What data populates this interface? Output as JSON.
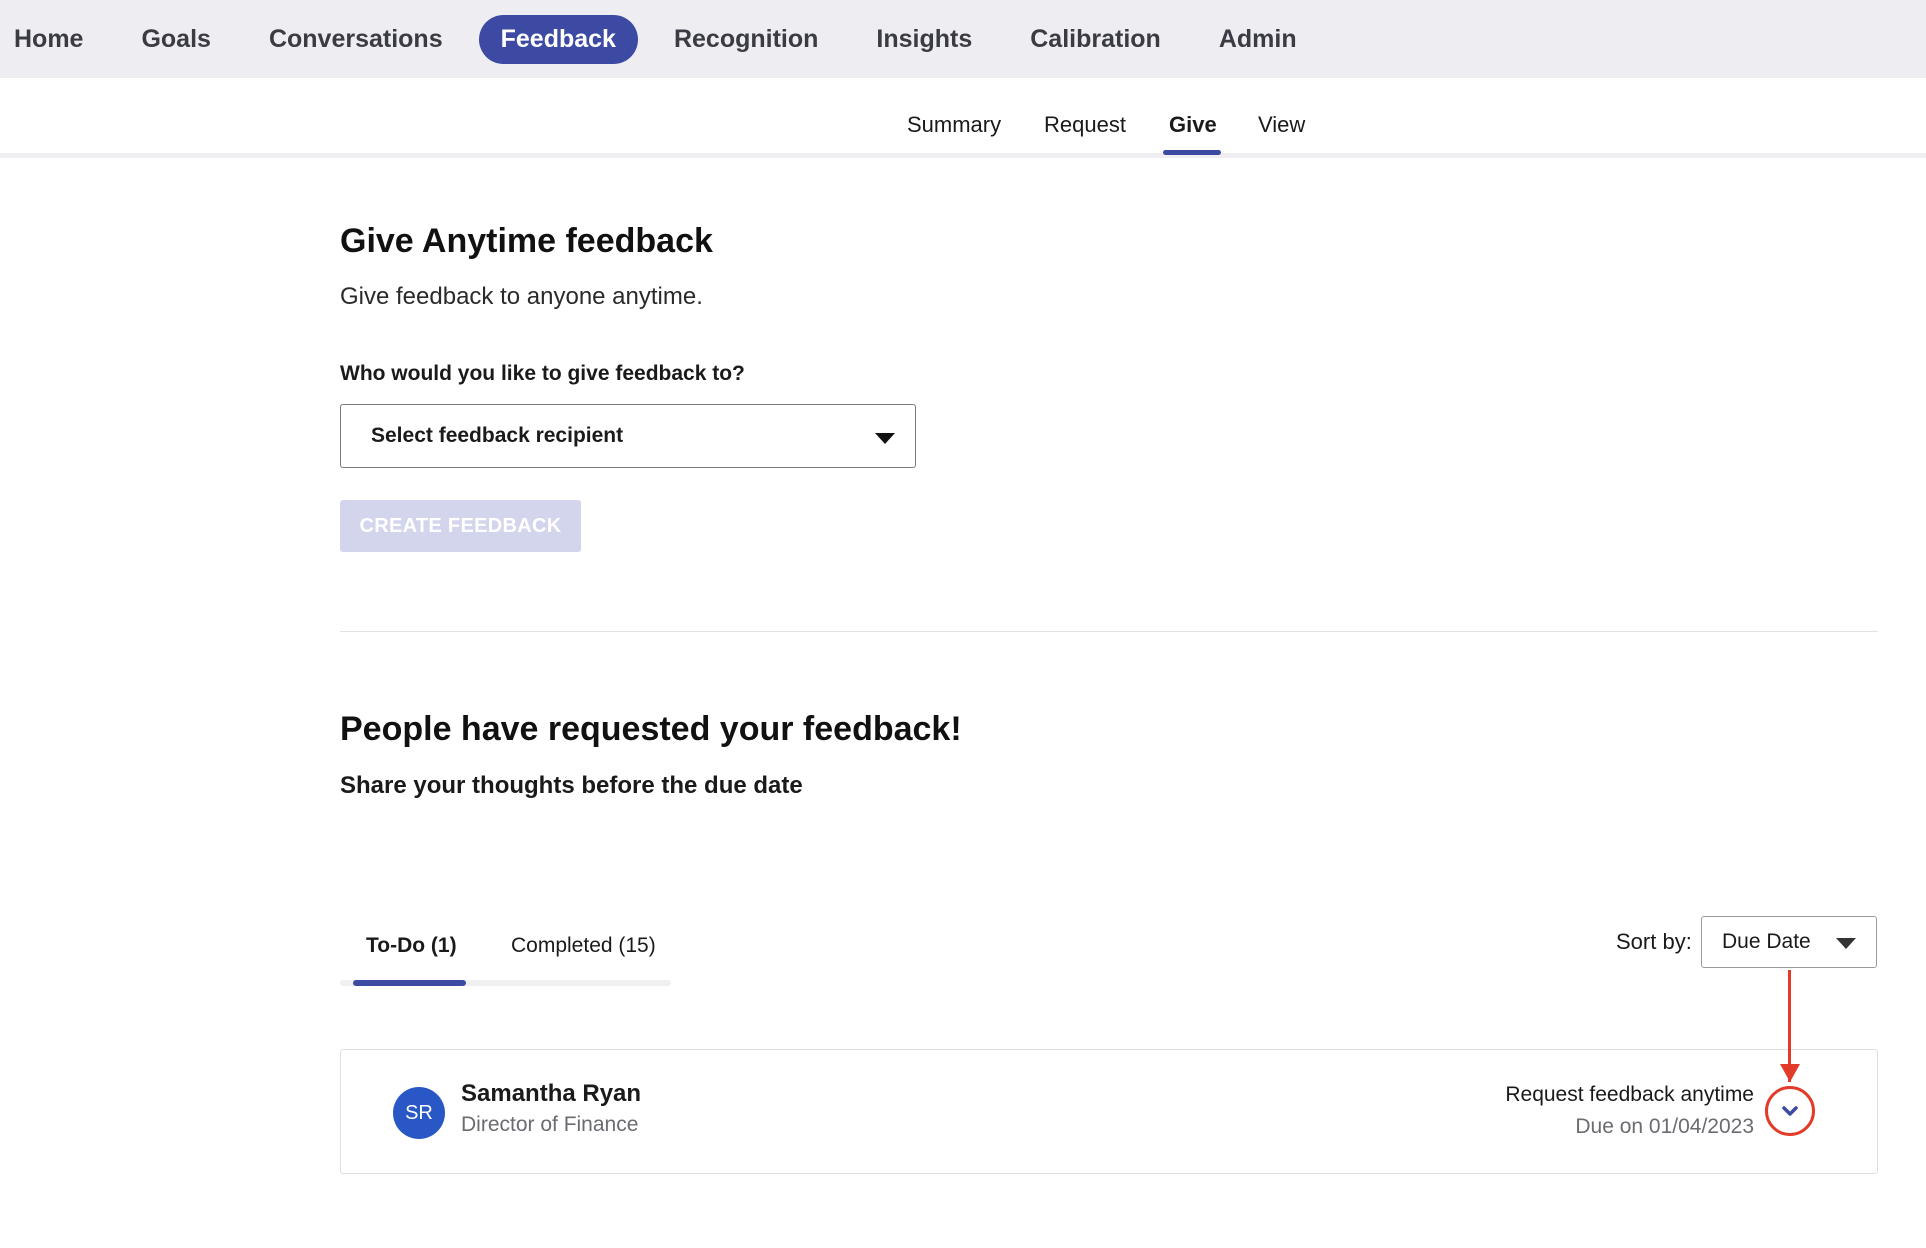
{
  "top_nav": {
    "items": [
      {
        "label": "Home"
      },
      {
        "label": "Goals"
      },
      {
        "label": "Conversations"
      },
      {
        "label": "Feedback",
        "active": true
      },
      {
        "label": "Recognition"
      },
      {
        "label": "Insights"
      },
      {
        "label": "Calibration"
      },
      {
        "label": "Admin"
      }
    ]
  },
  "sub_nav": {
    "items": [
      {
        "label": "Summary"
      },
      {
        "label": "Request"
      },
      {
        "label": "Give",
        "active": true
      },
      {
        "label": "View"
      }
    ]
  },
  "give_section": {
    "title": "Give Anytime feedback",
    "subtitle": "Give feedback to anyone anytime.",
    "question": "Who would you like to give feedback to?",
    "recipient_placeholder": "Select feedback recipient",
    "create_button": "CREATE FEEDBACK"
  },
  "requests_section": {
    "title": "People have requested your feedback!",
    "subtitle": "Share your thoughts before the due date",
    "tabs": [
      {
        "label": "To-Do (1)",
        "active": true
      },
      {
        "label": "Completed (15)"
      }
    ],
    "sort": {
      "label": "Sort by:",
      "value": "Due Date"
    },
    "items": [
      {
        "initials": "SR",
        "name": "Samantha Ryan",
        "title": "Director of Finance",
        "request_type": "Request feedback anytime",
        "due": "Due on 01/04/2023"
      }
    ]
  },
  "colors": {
    "accent": "#3d4aa3",
    "avatar": "#2a57c6",
    "annotation": "#e23b2a",
    "disabled_button": "#d3d5ec"
  },
  "icons": {
    "recipient_dropdown": "caret-down-icon",
    "sort_dropdown": "caret-down-icon",
    "expand": "chevron-down-icon",
    "annotation": "arrow-down-icon"
  }
}
